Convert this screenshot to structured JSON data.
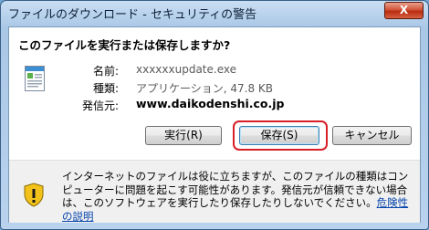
{
  "window": {
    "title": "ファイルのダウンロード - セキュリティの警告",
    "close_label": "X"
  },
  "prompt": {
    "question": "このファイルを実行または保存しますか?"
  },
  "file": {
    "icon": "application-window-icon",
    "name_label": "名前:",
    "name_value": "xxxxxxupdate.exe",
    "type_label": "種類:",
    "type_value": "アプリケーション, 47.8 KB",
    "publisher_label": "発信元:",
    "publisher_value": "www.daikodenshi.co.jp"
  },
  "buttons": {
    "run": "実行(R)",
    "save": "保存(S)",
    "cancel": "キャンセル"
  },
  "warning": {
    "icon": "warning-shield-icon",
    "text": "インターネットのファイルは役に立ちますが、このファイルの種類はコンピューターに問題を起こす可能性があります。発信元が信頼できない場合は、このソフトウェアを実行したり保存したりしないでください。",
    "link": "危険性の説明"
  },
  "colors": {
    "highlight": "#d81e26",
    "link": "#0645ad",
    "warning_yellow": "#f2c21b"
  }
}
